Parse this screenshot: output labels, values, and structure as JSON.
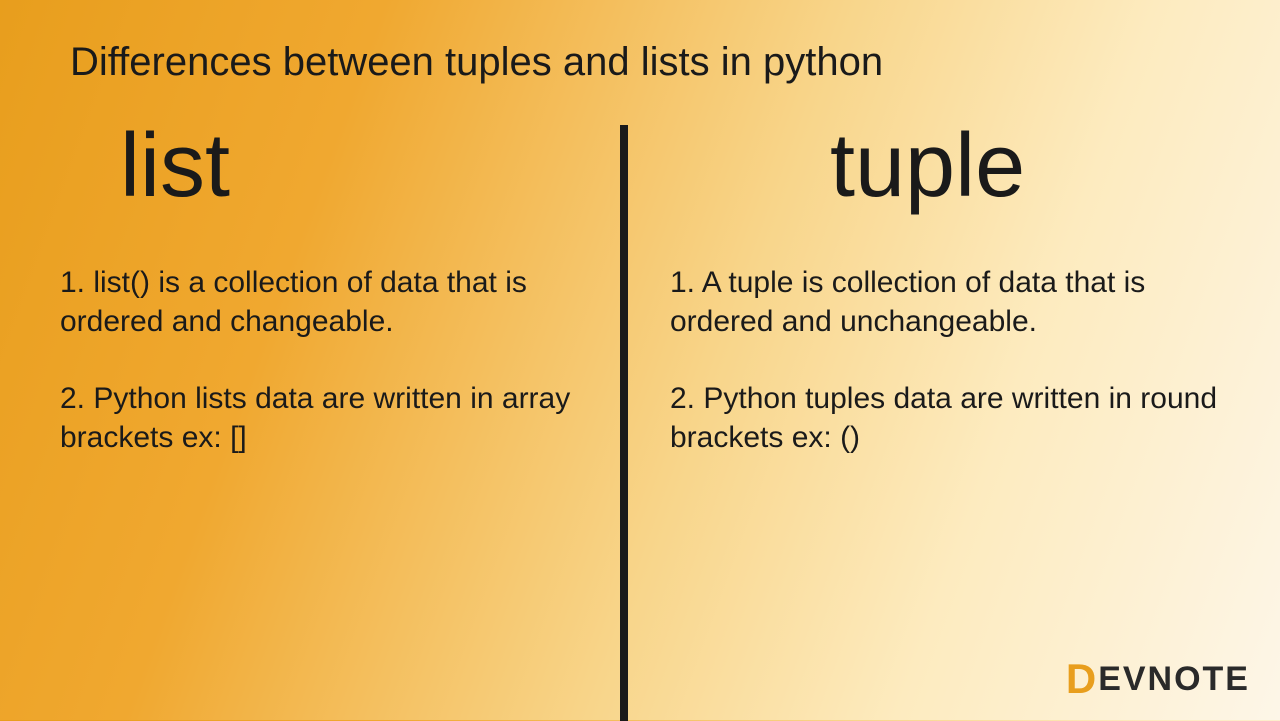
{
  "title": "Differences between tuples and lists in python",
  "left": {
    "heading": "list",
    "points": [
      "1. list() is a collection of data  that is ordered and changeable.",
      "2. Python lists data are written in array brackets ex: []"
    ]
  },
  "right": {
    "heading": "tuple",
    "points": [
      "1. A tuple is collection of data that is ordered and unchangeable.",
      "2. Python tuples data are written in round brackets  ex: ()"
    ]
  },
  "logo": {
    "d": "D",
    "text": "EVNOTE"
  }
}
